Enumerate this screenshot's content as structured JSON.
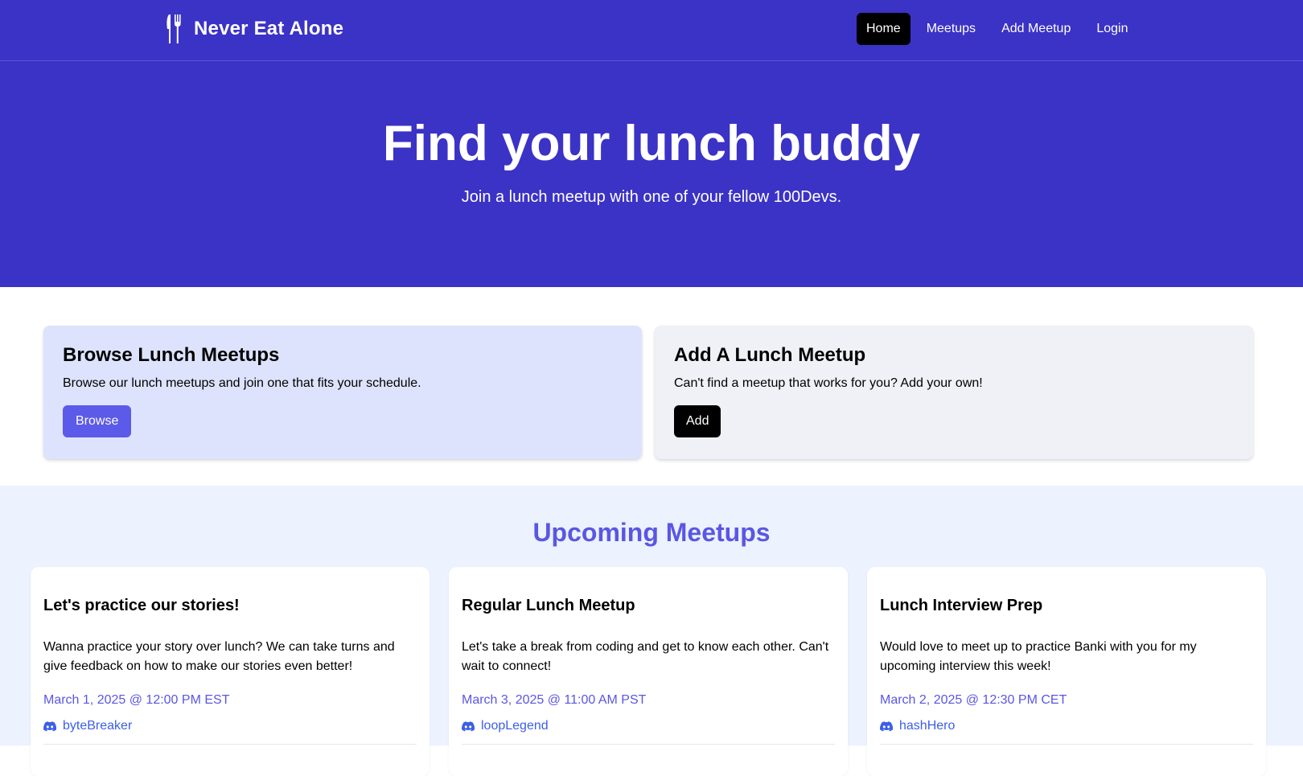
{
  "nav": {
    "brand": "Never Eat Alone",
    "links": [
      {
        "label": "Home",
        "active": true
      },
      {
        "label": "Meetups",
        "active": false
      },
      {
        "label": "Add Meetup",
        "active": false
      },
      {
        "label": "Login",
        "active": false
      }
    ]
  },
  "hero": {
    "title": "Find your lunch buddy",
    "subtitle": "Join a lunch meetup with one of your fellow 100Devs."
  },
  "actions": {
    "browse": {
      "title": "Browse Lunch Meetups",
      "text": "Browse our lunch meetups and join one that fits your schedule.",
      "button": "Browse"
    },
    "add": {
      "title": "Add A Lunch Meetup",
      "text": "Can't find a meetup that works for you? Add your own!",
      "button": "Add"
    }
  },
  "upcoming": {
    "title": "Upcoming Meetups",
    "meetups": [
      {
        "title": "Let's practice our stories!",
        "description": "Wanna practice your story over lunch? We can take turns and give feedback on how to make our stories even better!",
        "datetime": "March 1, 2025 @ 12:00 PM EST",
        "user": "byteBreaker",
        "icon": "discord-icon"
      },
      {
        "title": "Regular Lunch Meetup",
        "description": "Let's take a break from coding and get to know each other. Can't wait to connect!",
        "datetime": "March 3, 2025 @ 11:00 AM PST",
        "user": "loopLegend",
        "icon": "discord-icon"
      },
      {
        "title": "Lunch Interview Prep",
        "description": "Would love to meet up to practice Banki with you for my upcoming interview this week!",
        "datetime": "March 2, 2025 @ 12:30 PM CET",
        "user": "hashHero",
        "icon": "discord-icon"
      }
    ]
  },
  "colors": {
    "primary": "#3b32c6",
    "accent": "#5a56e4",
    "browse_card": "#dde3fc",
    "add_card": "#eff1f6",
    "upcoming_bg": "#ecf2fe",
    "link_blue": "#3c5ee8"
  }
}
